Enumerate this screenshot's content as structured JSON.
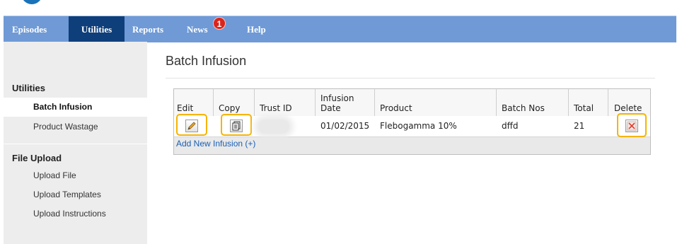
{
  "nav": {
    "items": [
      {
        "label": "Episodes",
        "active": false
      },
      {
        "label": "Utilities",
        "active": true
      },
      {
        "label": "Reports",
        "active": false
      },
      {
        "label": "News",
        "active": false,
        "badge": "1"
      },
      {
        "label": "Help",
        "active": false
      }
    ]
  },
  "sidebar": {
    "sections": [
      {
        "heading": "Utilities",
        "items": [
          "Batch Infusion",
          "Product Wastage"
        ],
        "active": "Batch Infusion"
      },
      {
        "heading": "File Upload",
        "items": [
          "Upload File",
          "Upload Templates",
          "Upload Instructions"
        ]
      }
    ]
  },
  "main": {
    "title": "Batch Infusion",
    "table": {
      "columns": [
        "Edit",
        "Copy",
        "Trust ID",
        "Infusion\nDate",
        "Product",
        "Batch Nos",
        "Total",
        "Delete"
      ],
      "rows": [
        {
          "trust_id": "",
          "infusion_date": "01/02/2015",
          "product": "Flebogamma 10%",
          "batch_nos": "dffd",
          "total": "21"
        }
      ],
      "add_link": "Add New Infusion (+)"
    }
  },
  "colors": {
    "nav_bg": "#6f9ad6",
    "nav_active": "#0f3f7a",
    "badge": "#d9251c",
    "highlight": "#f5b400",
    "link": "#1a5fb4"
  },
  "icons": {
    "edit": "pencil-icon",
    "copy": "copy-document-icon",
    "delete": "delete-x-icon"
  }
}
